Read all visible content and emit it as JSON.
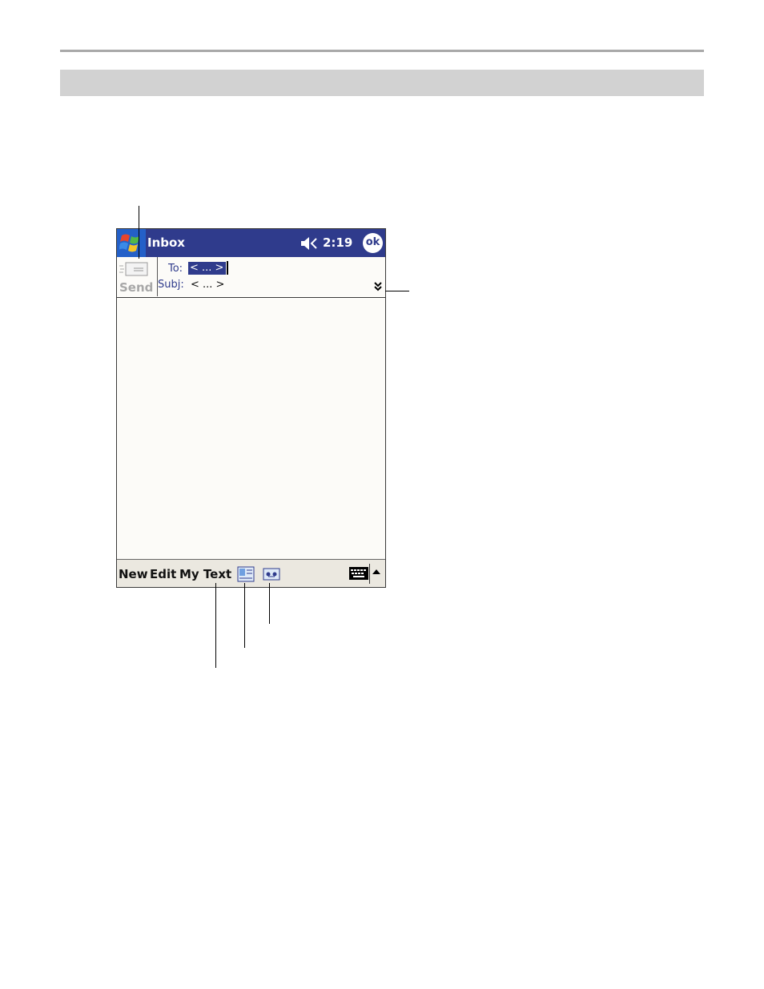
{
  "titlebar": {
    "title": "Inbox",
    "time": "2:19",
    "ok_label": "ok"
  },
  "message_header": {
    "send_label": "Send",
    "to_label": "To:",
    "to_value": "< ... >",
    "subject_label": "Subj:",
    "subject_value": "< ... >"
  },
  "menubar": {
    "items": [
      {
        "label": "New"
      },
      {
        "label": "Edit"
      },
      {
        "label": "My Text"
      }
    ]
  },
  "colors": {
    "titlebar_bg": "#2f3b8c",
    "start_button_bg": "#2460c8",
    "selection_bg": "#2f3b8c",
    "send_disabled": "#a8a8a8",
    "menubar_bg": "#ebe8e0",
    "page_band": "#d2d2d2"
  },
  "icons": [
    "windows-start-icon",
    "speaker-icon",
    "envelope-send-icon",
    "expand-header-icon",
    "address-book-icon",
    "recorder-icon",
    "keyboard-icon",
    "sip-arrow-up-icon"
  ]
}
